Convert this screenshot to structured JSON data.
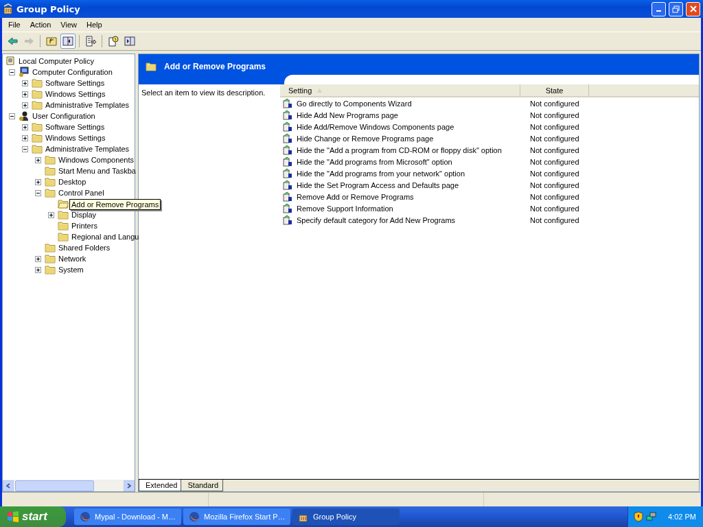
{
  "window": {
    "title": "Group Policy"
  },
  "menu": [
    "File",
    "Action",
    "View",
    "Help"
  ],
  "toolbar": [
    {
      "kind": "back",
      "disabled": false,
      "on": false
    },
    {
      "kind": "forward",
      "disabled": true,
      "on": false
    },
    {
      "kind": "up",
      "disabled": false,
      "on": false
    },
    {
      "kind": "tree",
      "disabled": false,
      "on": true
    },
    {
      "kind": "export",
      "disabled": false,
      "on": false
    },
    {
      "kind": "help",
      "disabled": false,
      "on": false
    },
    {
      "kind": "pane",
      "disabled": false,
      "on": false
    }
  ],
  "tree": [
    {
      "label": "Local Computer Policy",
      "kind": "policy",
      "selected": false,
      "children": [
        {
          "label": "Computer Configuration",
          "kind": "computer",
          "expanded": true,
          "selected": false,
          "children": [
            {
              "label": "Software Settings",
              "kind": "folder",
              "expanded": false,
              "selected": false
            },
            {
              "label": "Windows Settings",
              "kind": "folder",
              "expanded": false,
              "selected": false
            },
            {
              "label": "Administrative Templates",
              "kind": "folder",
              "expanded": false,
              "selected": false
            }
          ]
        },
        {
          "label": "User Configuration",
          "kind": "user",
          "expanded": true,
          "selected": false,
          "children": [
            {
              "label": "Software Settings",
              "kind": "folder",
              "expanded": false,
              "selected": false
            },
            {
              "label": "Windows Settings",
              "kind": "folder",
              "expanded": false,
              "selected": false
            },
            {
              "label": "Administrative Templates",
              "kind": "folder",
              "expanded": true,
              "selected": false,
              "children": [
                {
                  "label": "Windows Components",
                  "kind": "folder",
                  "expanded": false,
                  "selected": false
                },
                {
                  "label": "Start Menu and Taskba",
                  "kind": "folder",
                  "selected": false
                },
                {
                  "label": "Desktop",
                  "kind": "folder",
                  "expanded": false,
                  "selected": false
                },
                {
                  "label": "Control Panel",
                  "kind": "folder",
                  "expanded": true,
                  "selected": false,
                  "children": [
                    {
                      "label": "Add or Remove Programs",
                      "kind": "folder",
                      "selected": true,
                      "tooltip": true
                    },
                    {
                      "label": "Display",
                      "kind": "folder",
                      "expanded": false,
                      "selected": false
                    },
                    {
                      "label": "Printers",
                      "kind": "folder",
                      "selected": false
                    },
                    {
                      "label": "Regional and Langu",
                      "kind": "folder",
                      "selected": false
                    }
                  ]
                },
                {
                  "label": "Shared Folders",
                  "kind": "folder",
                  "selected": false
                },
                {
                  "label": "Network",
                  "kind": "folder",
                  "expanded": false,
                  "selected": false
                },
                {
                  "label": "System",
                  "kind": "folder",
                  "expanded": false,
                  "selected": false
                }
              ]
            }
          ]
        }
      ]
    }
  ],
  "details": {
    "title": "Add or Remove Programs",
    "description": "Select an item to view its description.",
    "columns": [
      "Setting",
      "State"
    ],
    "rows": [
      {
        "setting": "Go directly to Components Wizard",
        "state": "Not configured"
      },
      {
        "setting": "Hide Add New Programs page",
        "state": "Not configured"
      },
      {
        "setting": "Hide Add/Remove Windows Components page",
        "state": "Not configured"
      },
      {
        "setting": "Hide Change or Remove Programs page",
        "state": "Not configured"
      },
      {
        "setting": "Hide the \"Add a program from CD-ROM or floppy disk\" option",
        "state": "Not configured"
      },
      {
        "setting": "Hide the \"Add programs from Microsoft\" option",
        "state": "Not configured"
      },
      {
        "setting": "Hide the \"Add programs from your network\" option",
        "state": "Not configured"
      },
      {
        "setting": "Hide the Set Program Access and Defaults page",
        "state": "Not configured"
      },
      {
        "setting": "Remove Add or Remove Programs",
        "state": "Not configured"
      },
      {
        "setting": "Remove Support Information",
        "state": "Not configured"
      },
      {
        "setting": "Specify default category for Add New Programs",
        "state": "Not configured"
      }
    ]
  },
  "view_tabs": [
    {
      "label": "Extended",
      "selected": true
    },
    {
      "label": "Standard",
      "selected": false
    }
  ],
  "taskbar": {
    "start": "start",
    "tasks": [
      {
        "label": "Mypal - Download - M…",
        "kind": "browser",
        "selected": false
      },
      {
        "label": "Mozilla Firefox Start P…",
        "kind": "browser",
        "selected": false
      },
      {
        "label": "Group Policy",
        "kind": "policy",
        "selected": true
      }
    ],
    "clock": "4:02 PM"
  }
}
